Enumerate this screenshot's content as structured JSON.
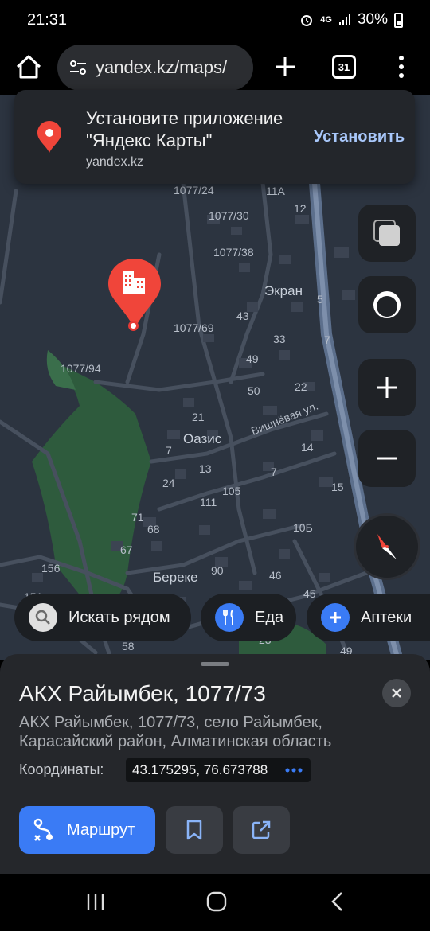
{
  "status_bar": {
    "time": "21:31",
    "network": "4G",
    "battery": "30%"
  },
  "browser": {
    "url": "yandex.kz/maps/",
    "tab_count": "31"
  },
  "install_banner": {
    "title": "Установите приложение \"Яндекс Карты\"",
    "domain": "yandex.kz",
    "button": "Установить"
  },
  "map": {
    "labels": [
      "1077/24",
      "11А",
      "12",
      "1077/30",
      "1077/38",
      "Экран",
      "5",
      "43",
      "1077/69",
      "7",
      "33",
      "49",
      "1077/94",
      "50",
      "22",
      "21",
      "Оазис",
      "Вишнёвая ул.",
      "14",
      "7",
      "13",
      "7",
      "24",
      "105",
      "15",
      "111",
      "71",
      "68",
      "10Б",
      "67",
      "156",
      "Береке",
      "90",
      "46",
      "45",
      "151",
      "58",
      "23",
      "49"
    ]
  },
  "chips": [
    {
      "label": "Искать рядом",
      "icon": "search-icon"
    },
    {
      "label": "Еда",
      "icon": "fork-knife-icon"
    },
    {
      "label": "Аптеки",
      "icon": "plus-cross-icon"
    }
  ],
  "place": {
    "title": "АКХ Райымбек, 1077/73",
    "address": "АКХ Райымбек, 1077/73, село Райымбек, Карасайский район, Алматинская область",
    "coords_label": "Координаты:",
    "coords_value": "43.175295, 76.673788"
  },
  "actions": {
    "route": "Маршрут"
  },
  "colors": {
    "accent": "#3a7bf5",
    "pin": "#f0453a",
    "link": "#a8c7fa"
  }
}
